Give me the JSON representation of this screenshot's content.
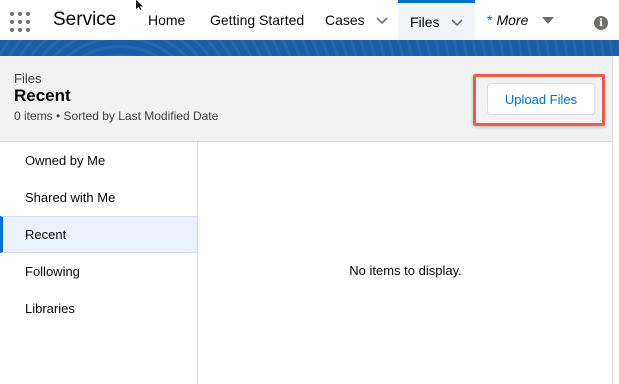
{
  "nav": {
    "app_name": "Service",
    "items": [
      {
        "label": "Home"
      },
      {
        "label": "Getting Started"
      },
      {
        "label": "Cases"
      },
      {
        "label": "Files"
      },
      {
        "label": "More",
        "prefix": "*"
      }
    ]
  },
  "header": {
    "object_label": "Files",
    "title": "Recent",
    "meta": "0 items • Sorted by Last Modified Date",
    "upload_button": "Upload Files"
  },
  "sidebar": {
    "items": [
      {
        "label": "Owned by Me"
      },
      {
        "label": "Shared with Me"
      },
      {
        "label": "Recent",
        "active": true
      },
      {
        "label": "Following"
      },
      {
        "label": "Libraries"
      }
    ]
  },
  "content": {
    "empty_message": "No items to display."
  },
  "colors": {
    "accent": "#0070d2",
    "band": "#1b5fa8",
    "highlight": "#e8604c"
  },
  "icons": [
    "app-launcher-icon",
    "chevron-down-icon",
    "caret-down-icon",
    "info-icon",
    "mouse-cursor-icon"
  ]
}
